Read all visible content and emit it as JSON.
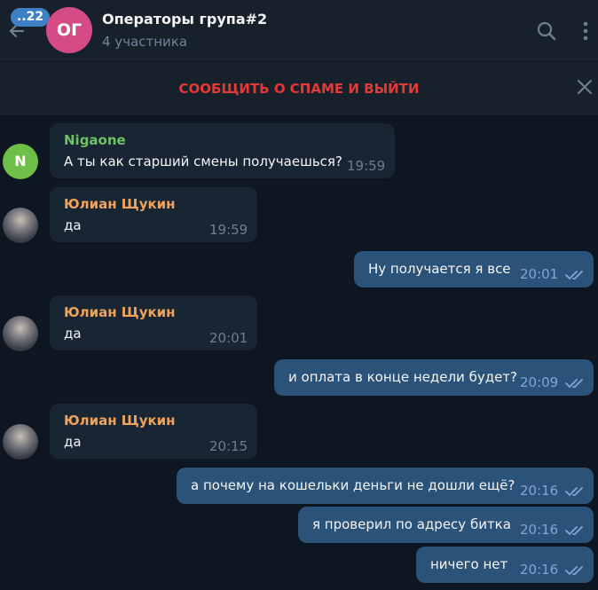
{
  "header": {
    "unread_badge": "..22",
    "avatar_initials": "ОГ",
    "title": "Операторы група#2",
    "subtitle": "4 участника",
    "back_icon": "arrow-left-icon",
    "search_icon": "search-icon",
    "more_icon": "more-vertical-icon"
  },
  "spam_bar": {
    "label": "СООБЩИТЬ О СПАМЕ И ВЫЙТИ",
    "close_icon": "close-icon"
  },
  "colors": {
    "background": "#0e1621",
    "panel": "#17212b",
    "incoming_bubble": "#182533",
    "outgoing_bubble": "#2b5278",
    "sender_nigaone": "#6dc266",
    "sender_yulian": "#f0a35a",
    "spam_red": "#e53935",
    "read_check": "#7da8d3"
  },
  "messages": [
    {
      "direction": "in",
      "sender": "Nigaone",
      "avatar_text": "N",
      "text": "А ты как старший смены получаешься?",
      "time": "19:59"
    },
    {
      "direction": "in",
      "sender": "Юлиан Щукин",
      "text": "да",
      "time": "19:59"
    },
    {
      "direction": "out",
      "text": "Ну получается я все",
      "time": "20:01",
      "status": "read"
    },
    {
      "direction": "in",
      "sender": "Юлиан Щукин",
      "text": "да",
      "time": "20:01"
    },
    {
      "direction": "out",
      "text": "и оплата в конце недели будет?",
      "time": "20:09",
      "status": "read"
    },
    {
      "direction": "in",
      "sender": "Юлиан Щукин",
      "text": "да",
      "time": "20:15"
    },
    {
      "direction": "out",
      "text": "а почему на кошельки деньги не дошли ещё?",
      "time": "20:16",
      "status": "read"
    },
    {
      "direction": "out",
      "text": "я проверил по адресу битка",
      "time": "20:16",
      "status": "read"
    },
    {
      "direction": "out",
      "text": "ничего нет",
      "time": "20:16",
      "status": "read"
    }
  ]
}
